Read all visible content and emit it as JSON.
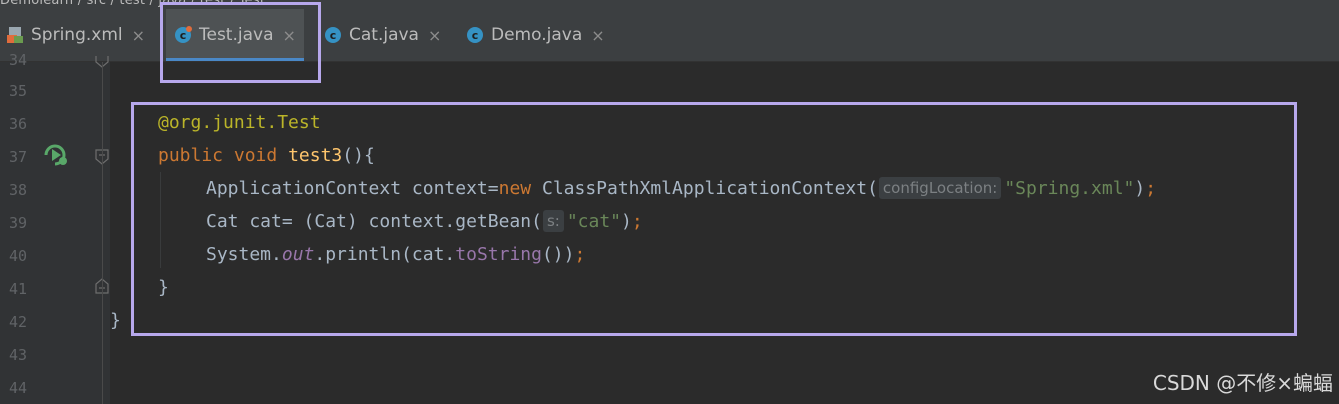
{
  "breadcrumb": {
    "text": "Demolearn  /  src  /  test  /  java  /  test  /  Test"
  },
  "tabs": [
    {
      "label": "Spring.xml",
      "icon": "xml-file-icon",
      "active": false
    },
    {
      "label": "Test.java",
      "icon": "java-class-icon",
      "active": true
    },
    {
      "label": "Cat.java",
      "icon": "java-class-icon",
      "active": false
    },
    {
      "label": "Demo.java",
      "icon": "java-class-icon",
      "active": false
    }
  ],
  "tab_close_glyph": "×",
  "line_numbers": [
    "34",
    "35",
    "36",
    "37",
    "38",
    "39",
    "40",
    "41",
    "42",
    "43",
    "44"
  ],
  "code": {
    "line36": {
      "at": "@",
      "annotation": "org.junit.",
      "annotation_name": "Test"
    },
    "line37": {
      "kw_public": "public",
      "kw_void": "void",
      "method": "test3",
      "rest": "(){"
    },
    "line38": {
      "type": "ApplicationContext",
      "var": " context=",
      "kw_new": "new",
      "ctor": " ClassPathXmlApplicationContext(",
      "hint": "configLocation:",
      "arg": "\"Spring.xml\"",
      "close": ")",
      "semi": ";"
    },
    "line39": {
      "decl": "Cat cat= (Cat) context.getBean(",
      "hint": "s:",
      "arg": "\"cat\"",
      "close": ")",
      "semi": ";"
    },
    "line40": {
      "system": "System.",
      "out": "out",
      "println": ".println(cat.",
      "tostring": "toString",
      "close": "())",
      "semi": ";"
    },
    "line41": {
      "brace": "}"
    },
    "line42": {
      "brace": "}"
    }
  },
  "gutter_icons": {
    "run": "run-test-icon",
    "fold_open": "fold-open-icon",
    "fold_close": "fold-close-icon"
  },
  "watermark": "CSDN @不修×蝙蝠",
  "colors": {
    "editor_bg": "#2b2b2b",
    "keyword": "#cc7832",
    "annotation": "#bbb529",
    "string": "#6a8759",
    "method_decl": "#ffc66d",
    "highlight_box": "#b7a8ec",
    "active_tab_underline": "#4a88c7"
  }
}
